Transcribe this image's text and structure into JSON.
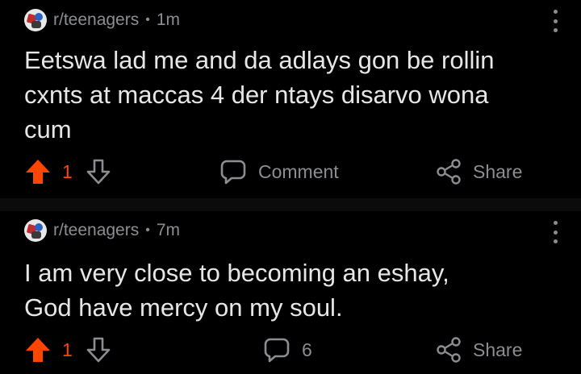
{
  "posts": [
    {
      "subreddit": "r/teenagers",
      "age": "1m",
      "title": "Eetswa lad me and da adlays gon be rollin\ncxnts at maccas 4 der ntays disarvo wona\ncum",
      "score": "1",
      "comment_label": "Comment",
      "share_label": "Share"
    },
    {
      "subreddit": "r/teenagers",
      "age": "7m",
      "title": "I am very close to becoming an eshay,\nGod have mercy on my soul.",
      "score": "1",
      "comment_label": "6",
      "share_label": "Share"
    }
  ],
  "meta_separator": "•",
  "colors": {
    "upvote_active": "#ff4500",
    "muted": "#8b8d91",
    "text": "#e6e6e6",
    "background": "#000000"
  }
}
